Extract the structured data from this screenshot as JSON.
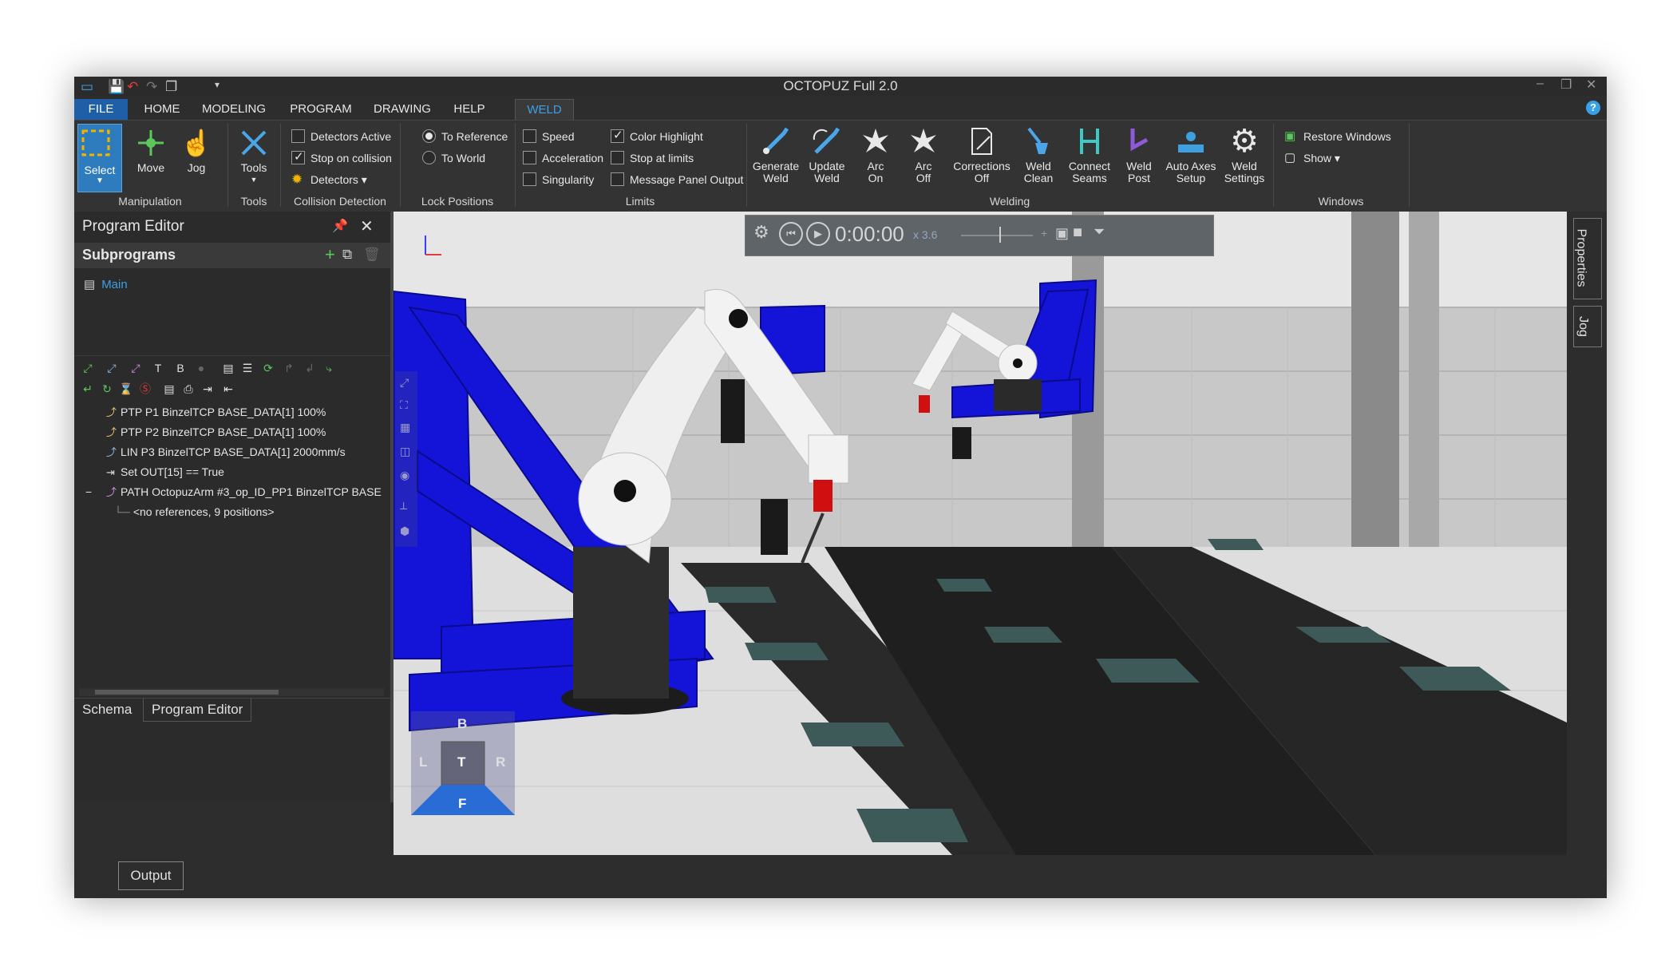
{
  "app": {
    "title": "OCTOPUZ Full 2.0"
  },
  "menu": {
    "tabs": [
      "FILE",
      "HOME",
      "MODELING",
      "PROGRAM",
      "DRAWING",
      "HELP",
      "WELD"
    ],
    "active": "WELD"
  },
  "ribbon": {
    "manipulation": {
      "label": "Manipulation",
      "buttons": [
        "Select",
        "Move",
        "Jog"
      ]
    },
    "tools": {
      "label": "Tools",
      "button": "Tools"
    },
    "collision": {
      "label": "Collision Detection",
      "detectors_active": "Detectors Active",
      "stop_on_collision": "Stop on collision",
      "detectors": "Detectors ▾",
      "detectors_active_checked": false,
      "stop_on_collision_checked": true
    },
    "lock": {
      "label": "Lock Positions",
      "to_reference": "To Reference",
      "to_world": "To World",
      "selected": "To Reference"
    },
    "limits": {
      "label": "Limits",
      "speed": "Speed",
      "acceleration": "Acceleration",
      "singularity": "Singularity",
      "color_highlight": "Color Highlight",
      "stop_at_limits": "Stop at limits",
      "message_panel_output": "Message Panel Output",
      "color_highlight_checked": true
    },
    "welding": {
      "label": "Welding",
      "buttons": [
        {
          "l1": "Generate",
          "l2": "Weld",
          "icon": "generate-weld-icon"
        },
        {
          "l1": "Update",
          "l2": "Weld",
          "icon": "update-weld-icon"
        },
        {
          "l1": "Arc",
          "l2": "On",
          "icon": "arc-on-icon"
        },
        {
          "l1": "Arc",
          "l2": "Off",
          "icon": "arc-off-icon"
        },
        {
          "l1": "Corrections",
          "l2": "Off",
          "icon": "corrections-off-icon"
        },
        {
          "l1": "Weld",
          "l2": "Clean",
          "icon": "weld-clean-icon"
        },
        {
          "l1": "Connect",
          "l2": "Seams",
          "icon": "connect-seams-icon"
        },
        {
          "l1": "Weld",
          "l2": "Post",
          "icon": "weld-post-icon"
        },
        {
          "l1": "Auto Axes",
          "l2": "Setup",
          "icon": "auto-axes-icon"
        },
        {
          "l1": "Weld",
          "l2": "Settings",
          "icon": "gear-icon"
        }
      ]
    },
    "windows": {
      "label": "Windows",
      "restore": "Restore Windows",
      "show": "Show ▾"
    }
  },
  "program_editor": {
    "title": "Program Editor",
    "subprograms_label": "Subprograms",
    "main": "Main",
    "tree": [
      "PTP P1 BinzelTCP BASE_DATA[1] 100%",
      "PTP P2 BinzelTCP BASE_DATA[1] 100%",
      "LIN P3 BinzelTCP BASE_DATA[1] 2000mm/s",
      "Set OUT[15] == True",
      "PATH OctopuzArm #3_op_ID_PP1 BinzelTCP BASE",
      "<no references, 9 positions>"
    ],
    "bottom_tabs": [
      "Schema",
      "Program Editor"
    ]
  },
  "viewport": {
    "time": "0:00:00",
    "speed": "x 3.6",
    "navcube": {
      "top": "B",
      "left": "L",
      "center": "T",
      "right": "R",
      "bottom": "F"
    }
  },
  "right_tabs": [
    "Properties",
    "Jog"
  ],
  "output_label": "Output",
  "colors": {
    "accent": "#3ca0e6",
    "file_tab": "#1e5fa8",
    "fixture_blue": "#1414d8"
  }
}
